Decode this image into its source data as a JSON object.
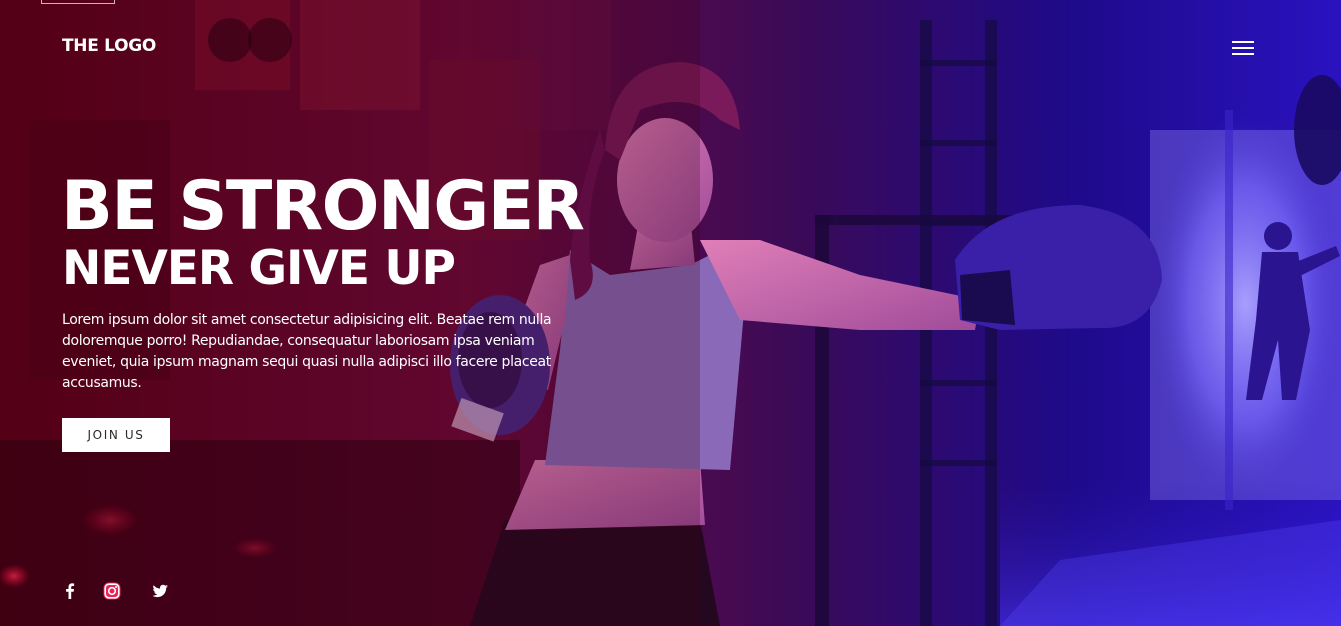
{
  "header": {
    "logo": "THE LOGO",
    "menu_icon": "hamburger-menu-icon"
  },
  "hero": {
    "headline": "BE STRONGER",
    "subheadline": "NEVER GIVE UP",
    "description": "Lorem ipsum dolor sit amet consectetur adipisicing elit. Beatae rem nulla doloremque porro! Repudiandae, consequatur laboriosam ipsa veniam eveniet, quia ipsum magnam sequi quasi nulla adipisci illo facere placeat accusamus.",
    "cta_label": "JOIN US",
    "background_image": "woman boxer throwing a punch in a gym with red and blue lighting"
  },
  "social": [
    {
      "name": "facebook",
      "icon": "facebook-icon"
    },
    {
      "name": "instagram",
      "icon": "instagram-icon"
    },
    {
      "name": "twitter",
      "icon": "twitter-icon"
    }
  ],
  "colors": {
    "overlay_left": "#7a0022",
    "overlay_right": "#2b10d6",
    "text": "#ffffff",
    "button_bg": "#ffffff",
    "button_text": "#2a2a2a"
  }
}
